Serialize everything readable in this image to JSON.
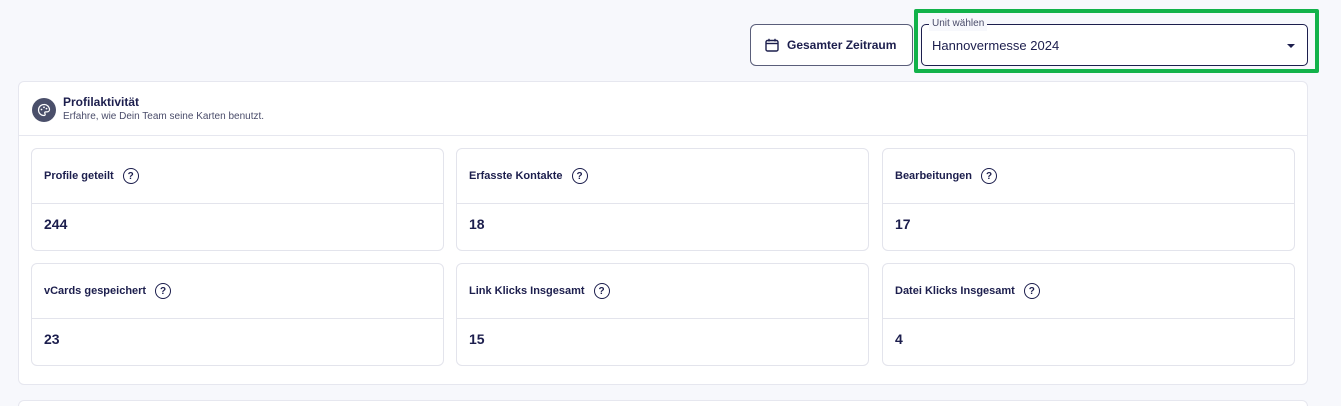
{
  "toolbar": {
    "date_range_label": "Gesamter Zeitraum",
    "date_icon": "calendar-icon",
    "unit_select": {
      "legend": "Unit wählen",
      "value": "Hannovermesse 2024",
      "icon": "chevron-down-icon"
    },
    "highlight_color": "#12b24a"
  },
  "panel": {
    "icon": "palette-icon",
    "title": "Profilaktivität",
    "subtitle": "Erfahre, wie Dein Team seine Karten benutzt.",
    "cards": [
      {
        "label": "Profile geteilt",
        "value": "244"
      },
      {
        "label": "Erfasste Kontakte",
        "value": "18"
      },
      {
        "label": "Bearbeitungen",
        "value": "17"
      },
      {
        "label": "vCards gespeichert",
        "value": "23"
      },
      {
        "label": "Link Klicks Insgesamt",
        "value": "15"
      },
      {
        "label": "Datei Klicks Insgesamt",
        "value": "4"
      }
    ],
    "help_icon_glyph": "?"
  }
}
